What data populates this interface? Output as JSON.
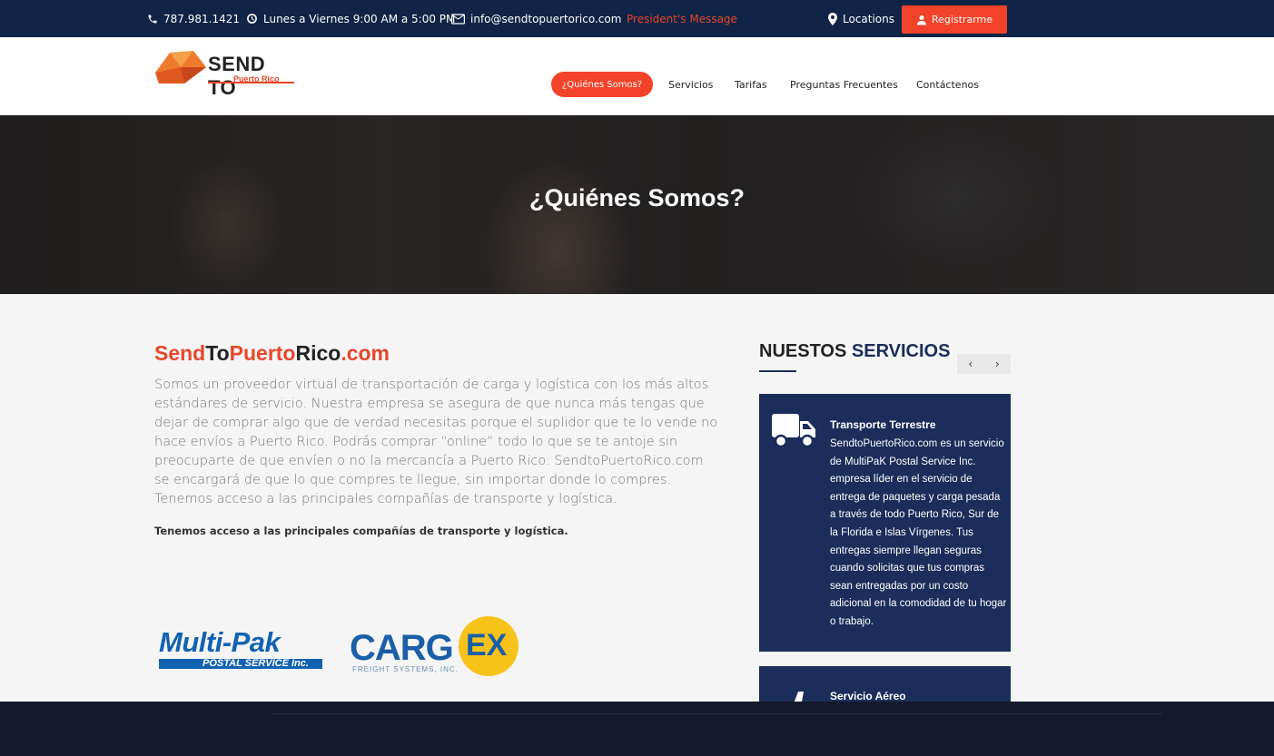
{
  "topbar": {
    "phone": "787.981.1421",
    "hours": "Lunes a Viernes 9:00 AM a 5:00 PM",
    "email": "info@sendtopuertorico.com",
    "presidents_message": "President's Message",
    "locations": "Locations",
    "register": "Registrarme"
  },
  "logo": {
    "main": "SEND TO",
    "sub": "Puerto Rico"
  },
  "nav": {
    "items": [
      "¿Quiénes Somos?",
      "Servicios",
      "Tarifas",
      "Preguntas Frecuentes",
      "Contáctenos"
    ]
  },
  "hero": {
    "title": "¿Quiénes Somos?"
  },
  "main": {
    "brand": {
      "send": "Send",
      "to": "To",
      "puerto": "Puerto",
      "rico": "Rico",
      "com": ".com"
    },
    "intro": "Somos un proveedor virtual de transportación de carga y logística con los más altos estándares de servicio. Nuestra empresa se asegura de que nunca más tengas que dejar de comprar algo que de verdad necesitas porque el suplidor que te lo vende no hace envíos a Puerto Rico. Podrás comprar “online” todo lo que se te antoje sin preocuparte de que envíen o no la mercancía a Puerto Rico. SendtoPuertoRico.com se encargará de que lo que compres te llegue, sin importar donde lo compres. Tenemos acceso a las principales compañías de transporte y logística.",
    "access": "Tenemos acceso a las principales compañías de transporte y logística.",
    "partners": {
      "multipak": {
        "name": "Multi-Pak",
        "sub": "POSTAL SERVICE Inc."
      },
      "cargex": {
        "main": "CARG",
        "ex": "EX",
        "sub": "FREIGHT SYSTEMS, INC."
      }
    }
  },
  "services": {
    "heading_a": "NUESTOS",
    "heading_b": "SERVICIOS",
    "prev": "‹",
    "next": "›",
    "cards": [
      {
        "icon": "truck-icon",
        "title": "Transporte Terrestre",
        "text": "SendtoPuertoRico.com es un servicio de MultiPaK Postal Service Inc. empresa líder en el servicio de entrega de paquetes y carga pesada a través de todo Puerto Rico, Sur de la Florida e Islas Vírgenes. Tus entregas siempre llegan seguras cuando solicitas que tus compras sean entregadas por un costo adicional en la comodidad de tu hogar o trabajo."
      },
      {
        "icon": "plane-icon",
        "title": "Servicio Aéreo",
        "text": ""
      }
    ]
  },
  "colors": {
    "accent": "#f2432a",
    "navy": "#1b2d5a",
    "topbar": "#0f2446",
    "footer": "#14192b"
  }
}
